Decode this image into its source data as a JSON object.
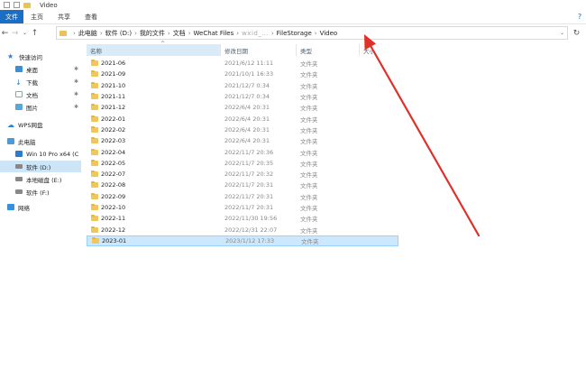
{
  "window": {
    "title": "Video"
  },
  "ribbon": {
    "tabs": [
      "文件",
      "主页",
      "共享",
      "查看"
    ],
    "help": "?"
  },
  "address": {
    "crumbs": [
      "此电脑",
      "软件 (D:)",
      "我的文件",
      "文档",
      "WeChat Files",
      "wxid_…",
      "FileStorage",
      "Video"
    ]
  },
  "sidebar": {
    "items": [
      {
        "label": "快速访问",
        "icon": "star-icon",
        "pinned": false
      },
      {
        "label": "桌面",
        "icon": "desktop-icon",
        "pinned": true
      },
      {
        "label": "下载",
        "icon": "download-icon",
        "pinned": true
      },
      {
        "label": "文档",
        "icon": "document-icon",
        "pinned": true
      },
      {
        "label": "图片",
        "icon": "pictures-icon",
        "pinned": true
      },
      {
        "label": "WPS网盘",
        "icon": "cloud-icon",
        "pinned": false
      },
      {
        "label": "此电脑",
        "icon": "pc-icon",
        "pinned": false
      },
      {
        "label": "Win 10 Pro x64 (C",
        "icon": "windows-drive-icon",
        "pinned": false
      },
      {
        "label": "软件 (D:)",
        "icon": "drive-icon",
        "pinned": false,
        "selected": true
      },
      {
        "label": "本地磁盘 (E:)",
        "icon": "drive-icon",
        "pinned": false
      },
      {
        "label": "软件 (F:)",
        "icon": "drive-icon",
        "pinned": false
      },
      {
        "label": "网络",
        "icon": "network-icon",
        "pinned": false
      }
    ]
  },
  "columns": {
    "name": "名称",
    "date": "修改日期",
    "type": "类型",
    "size": "大小"
  },
  "files": [
    {
      "name": "2021-06",
      "date": "2021/6/12 11:11",
      "type": "文件夹"
    },
    {
      "name": "2021-09",
      "date": "2021/10/1 16:33",
      "type": "文件夹"
    },
    {
      "name": "2021-10",
      "date": "2021/12/7 0:34",
      "type": "文件夹"
    },
    {
      "name": "2021-11",
      "date": "2021/12/7 0:34",
      "type": "文件夹"
    },
    {
      "name": "2021-12",
      "date": "2022/6/4 20:31",
      "type": "文件夹"
    },
    {
      "name": "2022-01",
      "date": "2022/6/4 20:31",
      "type": "文件夹"
    },
    {
      "name": "2022-02",
      "date": "2022/6/4 20:31",
      "type": "文件夹"
    },
    {
      "name": "2022-03",
      "date": "2022/6/4 20:31",
      "type": "文件夹"
    },
    {
      "name": "2022-04",
      "date": "2022/11/7 20:36",
      "type": "文件夹"
    },
    {
      "name": "2022-05",
      "date": "2022/11/7 20:35",
      "type": "文件夹"
    },
    {
      "name": "2022-07",
      "date": "2022/11/7 20:32",
      "type": "文件夹"
    },
    {
      "name": "2022-08",
      "date": "2022/11/7 20:31",
      "type": "文件夹"
    },
    {
      "name": "2022-09",
      "date": "2022/11/7 20:31",
      "type": "文件夹"
    },
    {
      "name": "2022-10",
      "date": "2022/11/7 20:31",
      "type": "文件夹"
    },
    {
      "name": "2022-11",
      "date": "2022/11/30 19:56",
      "type": "文件夹"
    },
    {
      "name": "2022-12",
      "date": "2022/12/31 22:07",
      "type": "文件夹"
    },
    {
      "name": "2023-01",
      "date": "2023/1/12 17:33",
      "type": "文件夹",
      "selected": true
    }
  ],
  "colors": {
    "accent": "#1a6fc4",
    "annotation_arrow": "#e0302a",
    "folder": "#f0c75a"
  }
}
